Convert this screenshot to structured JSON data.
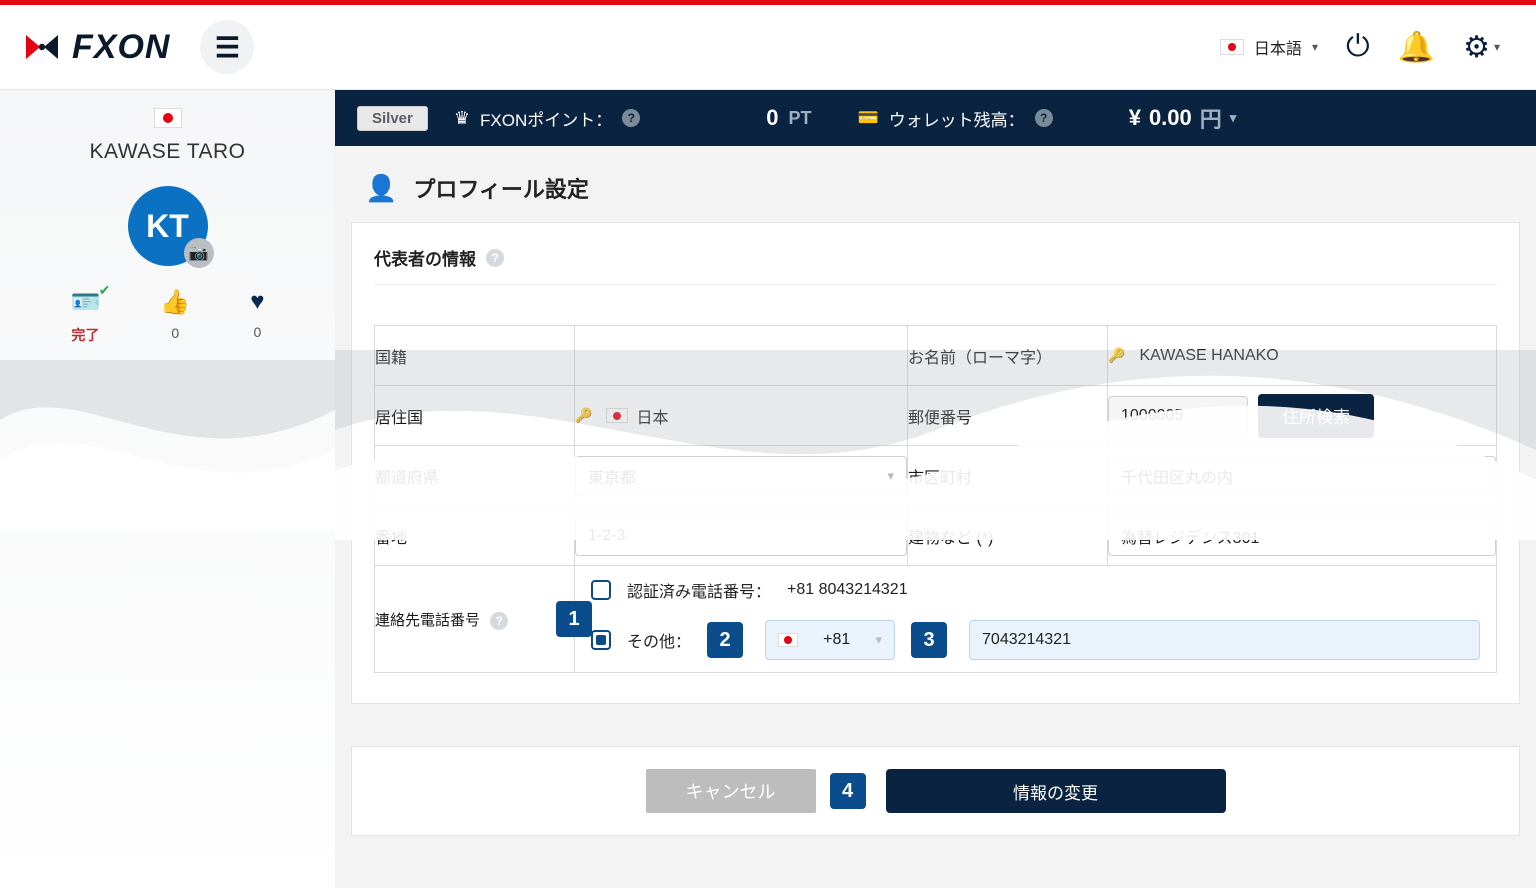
{
  "header": {
    "language_label": "日本語"
  },
  "sidebar": {
    "user_name": "KAWASE TARO",
    "avatar_initials": "KT",
    "stats": {
      "status_label": "完了",
      "likes": "0",
      "favs": "0"
    }
  },
  "darkbar": {
    "tier": "Silver",
    "points_label": "FXONポイント：",
    "points_value": "0",
    "points_unit": "PT",
    "wallet_label": "ウォレット残高：",
    "wallet_currency": "¥",
    "wallet_value": "0.00",
    "wallet_unit": "円"
  },
  "page": {
    "title": "プロフィール設定",
    "section_title": "代表者の情報"
  },
  "form": {
    "nationality_label": "国籍",
    "name_label": "お名前（ローマ字）",
    "name_value": "KAWASE HANAKO",
    "residence_label": "居住国",
    "residence_value": "日本",
    "postal_label": "郵便番号",
    "postal_value": "1000005",
    "addr_search_btn": "住所検索",
    "pref_label": "都道府県",
    "pref_value": "東京都",
    "city_label": "市区町村",
    "city_value": "千代田区丸の内",
    "street_label": "番地",
    "street_value": "1-2-3",
    "building_label": "建物など (*)",
    "building_value": "為替レジデンス301",
    "phone_label": "連絡先電話番号",
    "verified_phone_label": "認証済み電話番号：",
    "verified_phone_value": "+81 8043214321",
    "other_label": "その他：",
    "dial_code": "+81",
    "phone_value": "7043214321"
  },
  "actions": {
    "cancel": "キャンセル",
    "submit": "情報の変更"
  },
  "badges": {
    "b1": "1",
    "b2": "2",
    "b3": "3",
    "b4": "4"
  }
}
